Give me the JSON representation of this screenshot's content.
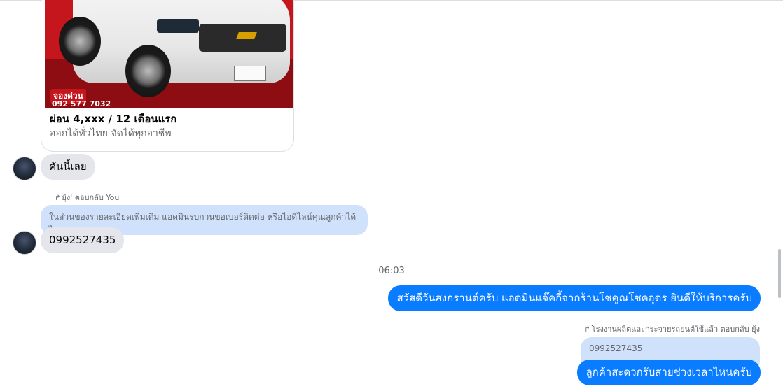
{
  "product_card": {
    "promo_tag": "จองด่วน",
    "phone_partial": "092 577 7032",
    "title": "ผ่อน 4,xxx / 12 เดือนแรก",
    "subtitle": "ออกได้ทั่วไทย จัดได้ทุกอาชีพ"
  },
  "messages": {
    "incoming_1": "คันนี้เลย",
    "reply_label_1": "ยุ้ง' ตอบกลับ You",
    "reply_quote_1": "ในส่วนของรายละเอียดเพิ่มเติม แอดมินรบกวนขอเบอร์ติดต่อ หรือไอดีไลน์คุณลูกค้าได้ไหมคะ",
    "incoming_2": "0992527435",
    "timestamp": "06:03",
    "outgoing_1": "สวัสดีวันสงกรานต์ครับ แอดมินแจ๊คกี้จากร้านโชคูณโชคอุดร ยินดีให้บริการครับ",
    "reply_label_2": "โรงงานผลิตและกระจายรถยนต์ใช้แล้ว ตอบกลับ ยุ้ง'",
    "reply_quote_2": "0992527435",
    "outgoing_2": "ลูกค้าสะดวกรับสายช่วงเวลาไหนครับ"
  },
  "colors": {
    "outgoing_bubble": "#0a7cff",
    "incoming_bubble": "#e4e6eb",
    "reply_quote": "#cfe1fb"
  },
  "icons": {
    "reply": "reply-arrow-icon"
  }
}
